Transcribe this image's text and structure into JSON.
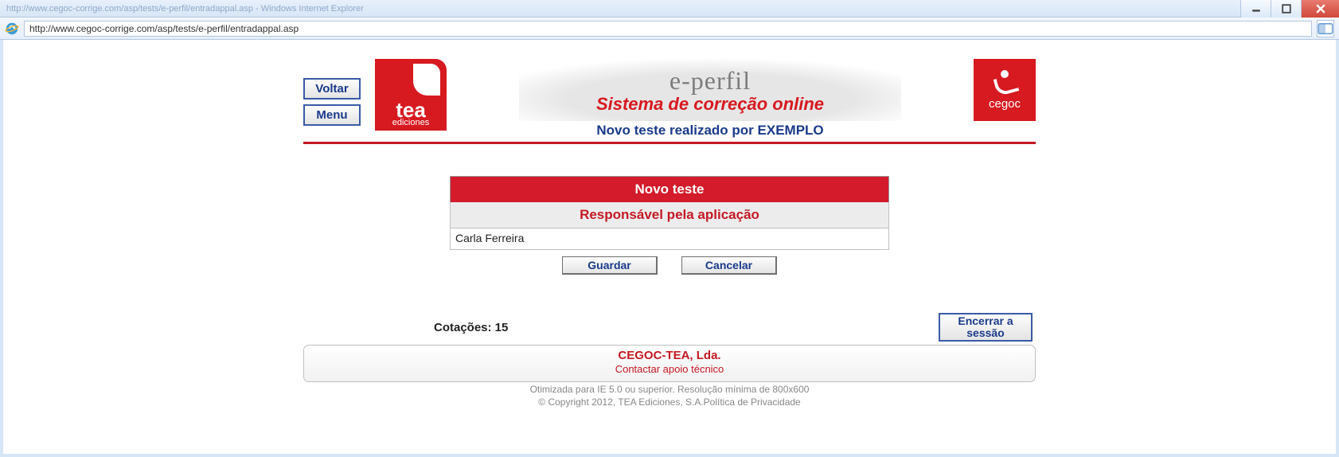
{
  "window": {
    "title": "http://www.cegoc-corrige.com/asp/tests/e-perfil/entradappal.asp - Windows Internet Explorer"
  },
  "address": {
    "url": "http://www.cegoc-corrige.com/asp/tests/e-perfil/entradappal.asp"
  },
  "nav": {
    "voltar": "Voltar",
    "menu": "Menu"
  },
  "logos": {
    "tea_main": "tea",
    "tea_sub": "ediciones",
    "cegoc": "cegoc"
  },
  "banner": {
    "eperfil": "e-perfil",
    "sistema": "Sistema de correção online",
    "subtitle": "Novo teste realizado por EXEMPLO"
  },
  "form": {
    "title": "Novo teste",
    "subtitle": "Responsável pela aplicação",
    "value": "Carla Ferreira",
    "save": "Guardar",
    "cancel": "Cancelar"
  },
  "lower": {
    "cotacoes_label": "Cotações: 15",
    "logout": "Encerrar a sessão"
  },
  "footer": {
    "company": "CEGOC-TEA, Lda.",
    "contact": "Contactar apoio técnico",
    "line1": "Otimizada para IE 5.0 ou superior. Resolução mínima de 800x600",
    "line2": "© Copyright 2012, TEA Ediciones, S.A.Política de Privacidade"
  }
}
